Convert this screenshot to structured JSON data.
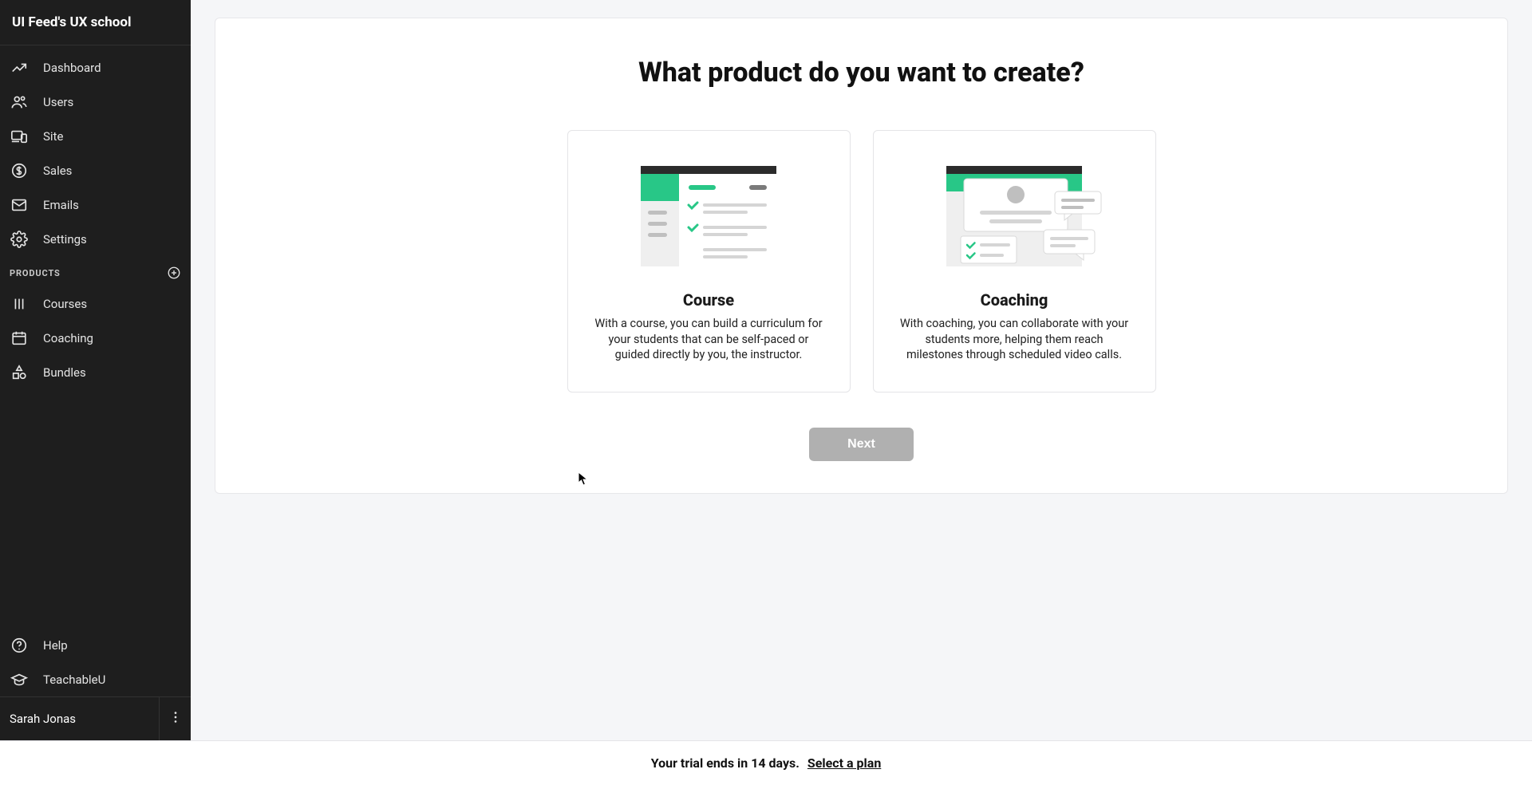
{
  "sidebar": {
    "title": "UI Feed's UX school",
    "nav": [
      {
        "label": "Dashboard"
      },
      {
        "label": "Users"
      },
      {
        "label": "Site"
      },
      {
        "label": "Sales"
      },
      {
        "label": "Emails"
      },
      {
        "label": "Settings"
      }
    ],
    "products_header": "PRODUCTS",
    "products": [
      {
        "label": "Courses"
      },
      {
        "label": "Coaching"
      },
      {
        "label": "Bundles"
      }
    ],
    "bottom": [
      {
        "label": "Help"
      },
      {
        "label": "TeachableU"
      }
    ],
    "user_name": "Sarah Jonas"
  },
  "main": {
    "heading": "What product do you want to create?",
    "options": {
      "course": {
        "title": "Course",
        "desc": "With a course, you can build a curriculum for your students that can be self-paced or guided directly by you, the instructor."
      },
      "coaching": {
        "title": "Coaching",
        "desc": "With coaching, you can collaborate with your students more, helping them reach milestones through scheduled video calls."
      }
    },
    "next_label": "Next"
  },
  "trial": {
    "message": "Your trial ends in 14 days.",
    "link": "Select a plan"
  }
}
